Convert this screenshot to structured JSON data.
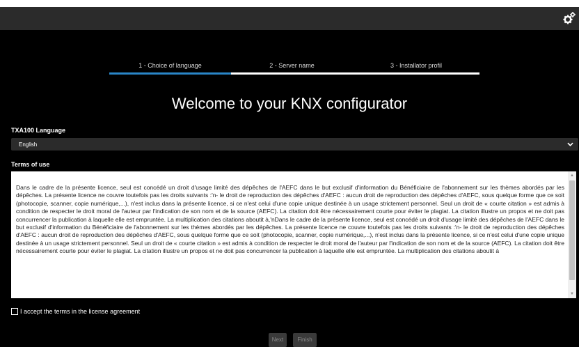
{
  "header": {
    "settings_icon": "gears-icon"
  },
  "stepper": {
    "steps": [
      {
        "label": "1 - Choice of language",
        "active": true
      },
      {
        "label": "2 - Server name",
        "active": false
      },
      {
        "label": "3 - Installator profil",
        "active": false
      }
    ]
  },
  "page": {
    "title": "Welcome to your KNX configurator"
  },
  "language": {
    "label": "TXA100 Language",
    "selected": "English"
  },
  "terms": {
    "label": "Terms of use",
    "text": "Dans le cadre de la présente licence, seul est concédé un droit d'usage limité des dépêches de l'AEFC dans le but exclusif d'information du Bénéficiaire de l'abonnement sur les thèmes abordés par les dépêches. La présente licence ne couvre toutefois pas les droits suivants :'n- le droit de reproduction des dépêches d'AEFC : aucun droit de reproduction des dépêches d'AEFC, sous quelque forme que ce soit (photocopie, scanner, copie numérique,...), n'est inclus dans la présente licence, si ce n'est celui d'une copie unique destinée à un usage strictement personnel. Seul un droit de « courte citation » est admis à condition de respecter le droit moral de l'auteur par l'indication de son nom et de la source (AEFC). La citation doit être nécessairement courte pour éviter le plagiat. La citation illustre un propos et ne doit pas concurrencer la publication à laquelle elle est empruntée. La multiplication des citations aboutit à,'nDans le cadre de la présente licence, seul est concédé un droit d'usage limité des dépêches de l'AEFC dans le but exclusif d'information du Bénéficiaire de l'abonnement sur les thèmes abordés par les dépêches. La présente licence ne couvre toutefois pas les droits suivants :'n- le droit de reproduction des dépêches d'AEFC : aucun droit de reproduction des dépêches d'AEFC, sous quelque forme que ce soit (photocopie, scanner, copie numérique,...), n'est inclus dans la présente licence, si ce n'est celui d'une copie unique destinée à un usage strictement personnel. Seul un droit de « courte citation » est admis à condition de respecter le droit moral de l'auteur par l'indication de son nom et de la source (AEFC). La citation doit être nécessairement courte pour éviter le plagiat. La citation illustre un propos et ne doit pas concurrencer la publication à laquelle elle est empruntée. La multiplication des citations aboutit à"
  },
  "accept": {
    "label": "I accept the terms in the license agreement",
    "checked": false
  },
  "buttons": {
    "next": "Next",
    "finish": "Finish"
  },
  "colors": {
    "background": "#000000",
    "topbar": "#2b2b2b",
    "accent": "#2a86c8",
    "button_bg": "#3a3a3a",
    "button_text_disabled": "#8a8a8a"
  }
}
